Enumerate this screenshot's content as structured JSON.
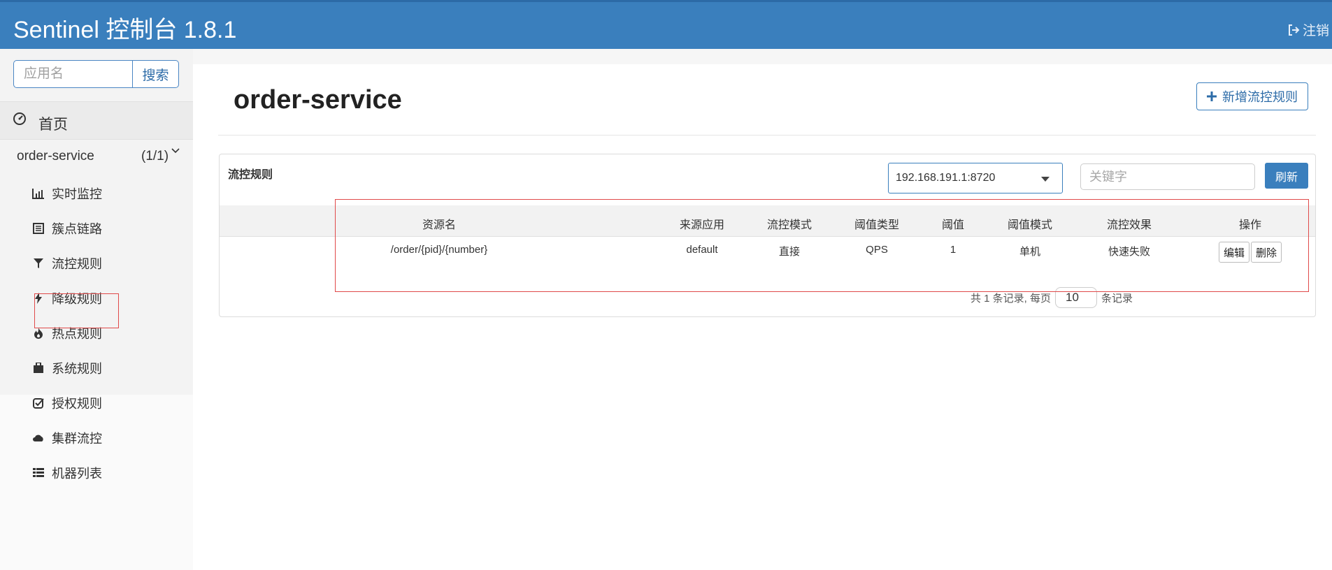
{
  "header": {
    "title": "Sentinel 控制台 1.8.1",
    "logout_label": "注销"
  },
  "sidebar": {
    "search_placeholder": "应用名",
    "search_button": "搜索",
    "home_label": "首页",
    "app": {
      "name": "order-service",
      "count": "(1/1)"
    },
    "menu": [
      {
        "label": "实时监控",
        "icon": "bar-chart-icon"
      },
      {
        "label": "簇点链路",
        "icon": "list-icon"
      },
      {
        "label": "流控规则",
        "icon": "filter-icon"
      },
      {
        "label": "降级规则",
        "icon": "flash-icon"
      },
      {
        "label": "热点规则",
        "icon": "fire-icon"
      },
      {
        "label": "系统规则",
        "icon": "lock-icon"
      },
      {
        "label": "授权规则",
        "icon": "check-square-icon"
      },
      {
        "label": "集群流控",
        "icon": "cloud-icon"
      },
      {
        "label": "机器列表",
        "icon": "th-list-icon"
      }
    ],
    "active_item": "流控规则"
  },
  "main": {
    "title": "order-service",
    "add_button": "新增流控规则",
    "panel_title": "流控规则",
    "machine_select": "192.168.191.1:8720",
    "keyword_placeholder": "关键字",
    "refresh_button": "刷新",
    "table": {
      "headers": [
        "资源名",
        "来源应用",
        "流控模式",
        "阈值类型",
        "阈值",
        "阈值模式",
        "流控效果",
        "操作"
      ],
      "rows": [
        {
          "resource": "/order/{pid}/{number}",
          "limit_app": "default",
          "strategy": "直接",
          "grade": "QPS",
          "count": "1",
          "cluster_mode": "单机",
          "control_behavior": "快速失败",
          "edit": "编辑",
          "delete": "删除"
        }
      ]
    },
    "pager": {
      "prefix": "共 1 条记录, 每页",
      "page_size": "10",
      "suffix": "条记录"
    }
  },
  "colors": {
    "header_bg": "#3a7fbd",
    "accent": "#2d6ca8",
    "highlight": "#e04a4a"
  }
}
